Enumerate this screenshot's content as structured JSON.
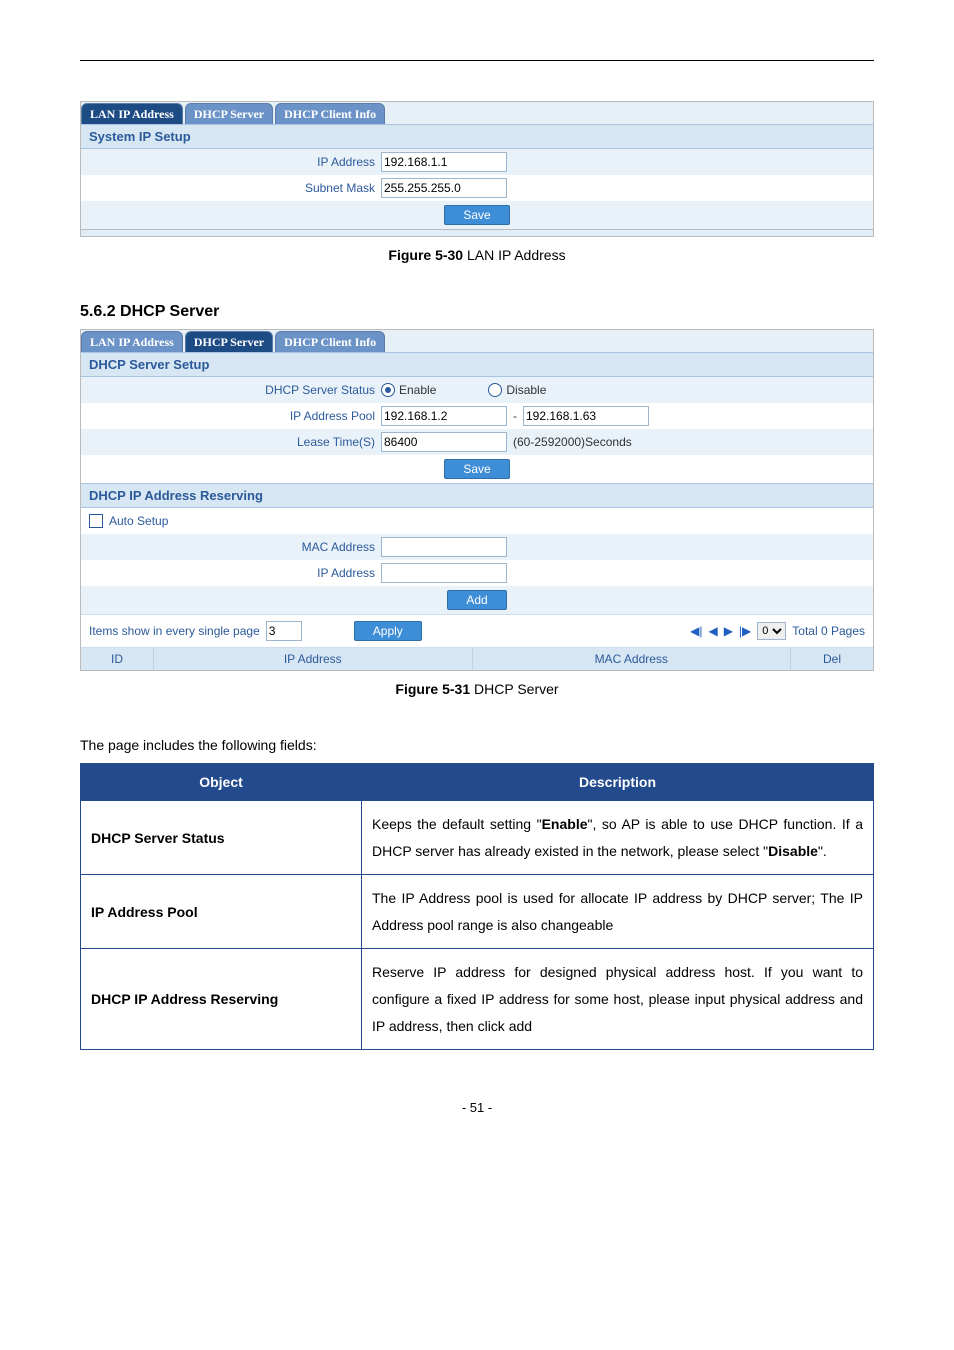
{
  "ss1": {
    "tabs": [
      "LAN IP Address",
      "DHCP Server",
      "DHCP Client Info"
    ],
    "active_tab_index": 0,
    "panel_title": "System IP Setup",
    "rows": {
      "ip_label": "IP Address",
      "ip_value": "192.168.1.1",
      "mask_label": "Subnet Mask",
      "mask_value": "255.255.255.0"
    },
    "save_btn": "Save",
    "caption_bold": "Figure 5-30",
    "caption_rest": " LAN IP Address"
  },
  "section_heading": "5.6.2  DHCP Server",
  "ss2": {
    "tabs": [
      "LAN IP Address",
      "DHCP Server",
      "DHCP Client Info"
    ],
    "active_tab_index": 1,
    "panel1_title": "DHCP Server Setup",
    "status_label": "DHCP Server Status",
    "status_enable": "Enable",
    "status_disable": "Disable",
    "pool_label": "IP Address Pool",
    "pool_start": "192.168.1.2",
    "pool_dash": "-",
    "pool_end": "192.168.1.63",
    "lease_label": "Lease Time(S)",
    "lease_value": "86400",
    "lease_hint": "(60-2592000)Seconds",
    "save_btn": "Save",
    "panel2_title": "DHCP IP Address Reserving",
    "auto_setup_label": "Auto Setup",
    "mac_label": "MAC Address",
    "ip_label": "IP Address",
    "add_btn": "Add",
    "items_label": "Items show in every single page",
    "items_value": "3",
    "apply_btn": "Apply",
    "page_select": "0",
    "page_suffix": "Total 0 Pages",
    "col_id": "ID",
    "col_ip": "IP Address",
    "col_mac": "MAC Address",
    "col_del": "Del",
    "caption_bold": "Figure 5-31",
    "caption_rest": " DHCP Server"
  },
  "lead_text": "The page includes the following fields:",
  "desc_table": {
    "head_object": "Object",
    "head_description": "Description",
    "rows": [
      {
        "object": "DHCP Server Status",
        "desc_pre": "Keeps the default setting \"",
        "desc_b1": "Enable",
        "desc_mid": "\", so AP is able to use DHCP function. If a DHCP server has already existed in the network, please select \"",
        "desc_b2": "Disable",
        "desc_post": "\"."
      },
      {
        "object": "IP Address Pool",
        "desc_plain": "The IP Address pool is used for allocate IP address by DHCP server; The IP Address pool range is also changeable"
      },
      {
        "object": "DHCP IP Address Reserving",
        "desc_plain": "Reserve IP address for designed physical address host. If you want to configure a fixed IP address for some host, please input physical address and IP address, then click add"
      }
    ]
  },
  "page_number": "- 51 -"
}
